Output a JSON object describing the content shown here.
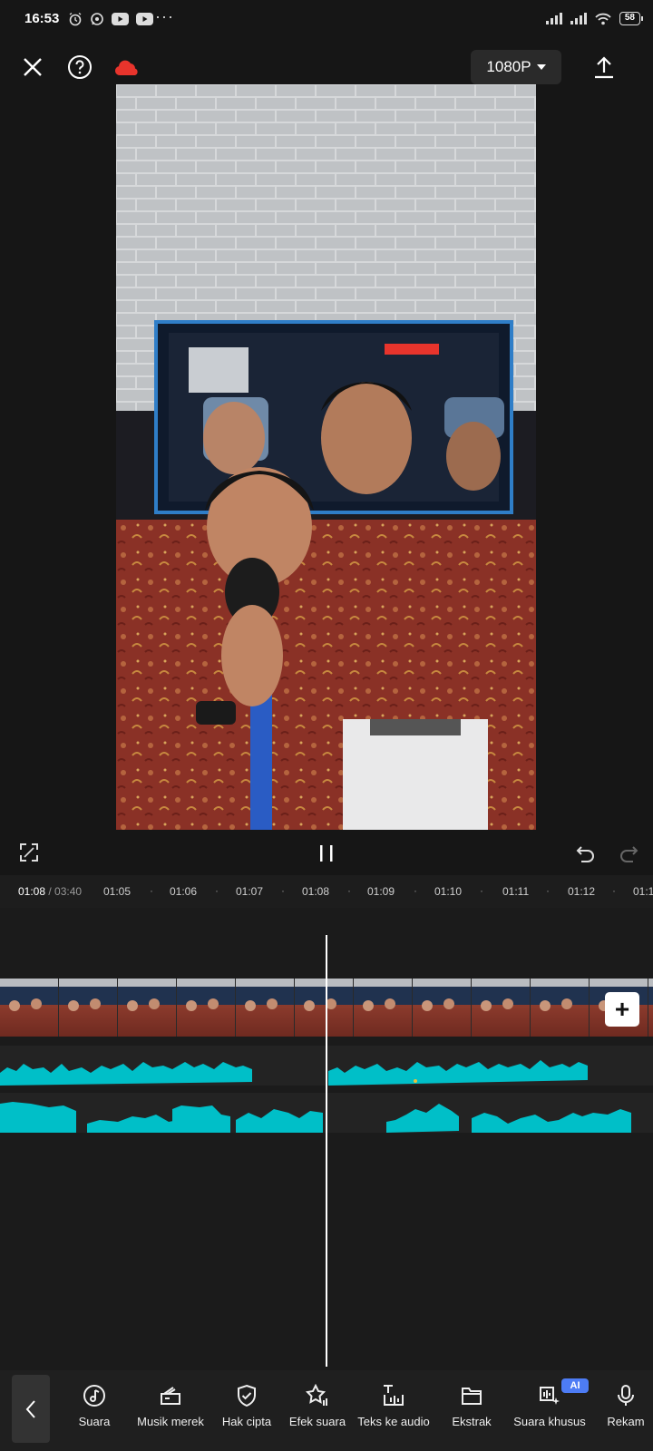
{
  "status_bar": {
    "time": "16:53",
    "left_icons": [
      "alarm-icon",
      "whatsapp-icon",
      "youtube-icon",
      "youtube-icon"
    ],
    "more": "···",
    "right_icons": [
      "signal-icon",
      "signal-icon",
      "wifi-icon"
    ],
    "battery": "58"
  },
  "top_bar": {
    "resolution": "1080P",
    "icons": [
      "close-icon",
      "help-icon",
      "cloud-icon",
      "export-icon"
    ]
  },
  "playback": {
    "icons": [
      "fullscreen-icon",
      "pause-icon",
      "undo-icon",
      "redo-icon"
    ]
  },
  "ruler": {
    "current_time": "01:08",
    "total_time": "/ 03:40",
    "ticks": [
      "01:05",
      "01:06",
      "01:07",
      "01:08",
      "01:09",
      "01:10",
      "01:11",
      "01:12",
      "01:1"
    ]
  },
  "timeline": {
    "add_label": "+"
  },
  "bottom_toolbar": {
    "tools": [
      {
        "label": "Suara",
        "icon": "music-note-icon"
      },
      {
        "label": "Musik merek",
        "icon": "music-brand-icon"
      },
      {
        "label": "Hak cipta",
        "icon": "copyright-shield-icon"
      },
      {
        "label": "Efek suara",
        "icon": "sound-effect-star-icon"
      },
      {
        "label": "Teks ke audio",
        "icon": "text-to-audio-icon"
      },
      {
        "label": "Ekstrak",
        "icon": "extract-folder-icon"
      },
      {
        "label": "Suara khusus",
        "icon": "custom-voice-icon"
      },
      {
        "label": "Rekam",
        "icon": "microphone-icon"
      }
    ],
    "ai_badge": "AI"
  },
  "colors": {
    "accent": "#00c2c7",
    "background": "#161616",
    "cloud": "#e8342c"
  }
}
